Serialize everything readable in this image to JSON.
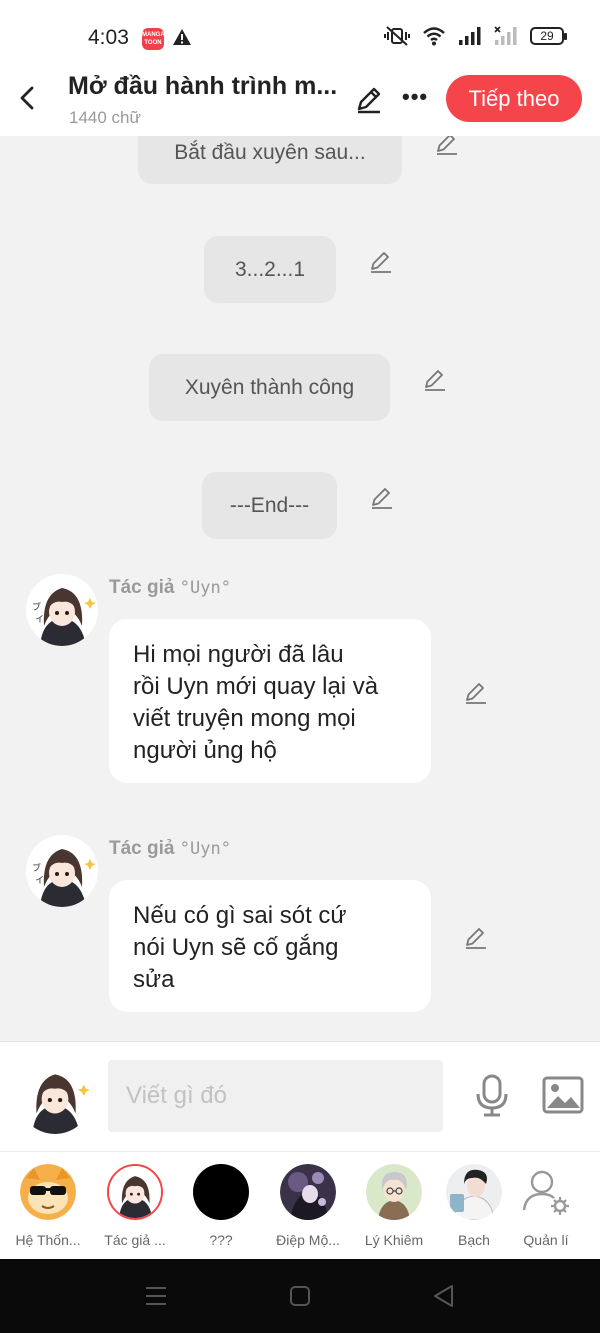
{
  "status": {
    "time": "4:03",
    "app_icon_text": "MANGA TOON",
    "battery": "29"
  },
  "header": {
    "title": "Mở đầu hành trình m...",
    "word_count": "1440 chữ",
    "next_label": "Tiếp theo"
  },
  "narration": [
    {
      "text": "Bắt đầu xuyên sau..."
    },
    {
      "text": "3...2...1"
    },
    {
      "text": "Xuyên thành công"
    },
    {
      "text": "---End---"
    }
  ],
  "messages": [
    {
      "author": "Tác giả",
      "author_suffix": "°Uyn°",
      "text_lines": [
        "Hi mọi người đã lâu",
        "rồi Uyn mới quay lại và",
        "viết truyện mong mọi",
        "người ủng hộ"
      ]
    },
    {
      "author": "Tác giả",
      "author_suffix": "°Uyn°",
      "text_lines": [
        "Nếu có gì sai sót cứ",
        "nói Uyn sẽ cố gắng",
        "sửa"
      ]
    }
  ],
  "composer": {
    "placeholder": "Viết gì đó"
  },
  "characters": [
    {
      "label": "Hệ Thốn..."
    },
    {
      "label": "Tác giả ..."
    },
    {
      "label": "???"
    },
    {
      "label": "Điệp Mộ..."
    },
    {
      "label": "Lý Khiêm"
    },
    {
      "label": "Bạch"
    },
    {
      "label": "Quản lí"
    }
  ],
  "colors": {
    "accent": "#f5454b",
    "chat_bg": "#f2f2f2",
    "narration_bg": "#e6e6e6"
  },
  "icons": [
    "back-icon",
    "edit-icon",
    "more-icon",
    "microphone-icon",
    "image-icon",
    "manage-user-icon"
  ]
}
